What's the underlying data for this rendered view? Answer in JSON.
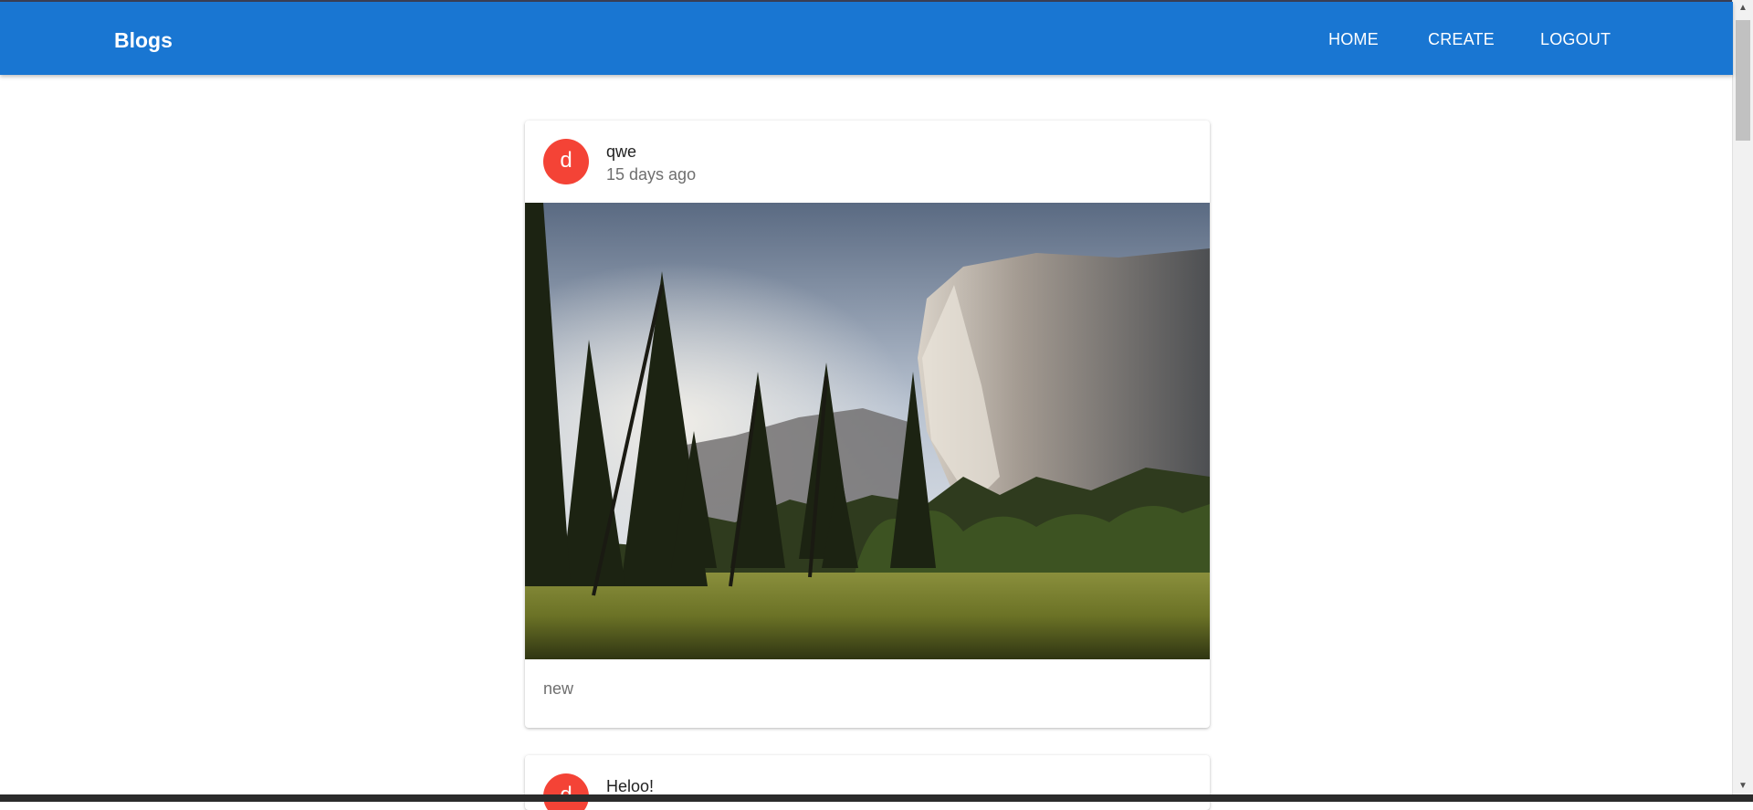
{
  "app": {
    "title": "Blogs"
  },
  "nav": {
    "home": "HOME",
    "create": "CREATE",
    "logout": "LOGOUT"
  },
  "posts": [
    {
      "avatar_letter": "d",
      "title": "qwe",
      "subtitle": "15 days ago",
      "image": "mountain-forest-meadow-photo",
      "body": "new"
    },
    {
      "avatar_letter": "d",
      "title": "Heloo!"
    }
  ],
  "colors": {
    "appbar": "#1976d2",
    "avatar": "#f44336",
    "background": "#ffffff"
  }
}
